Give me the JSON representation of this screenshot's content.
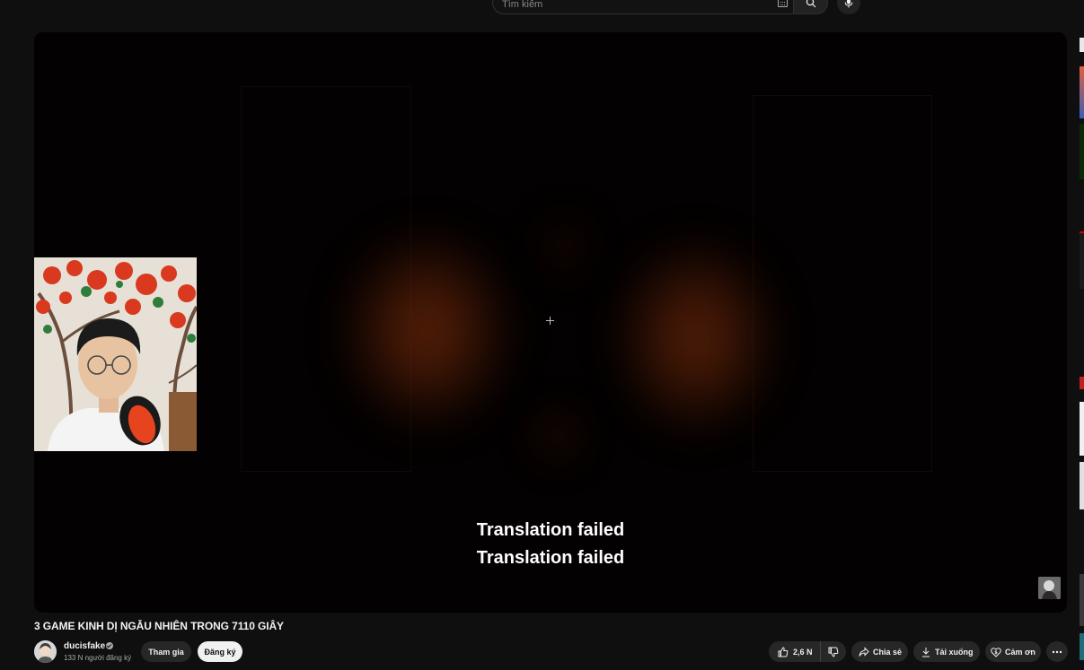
{
  "search": {
    "placeholder": "Tìm kiếm",
    "search_icon": "search-icon",
    "mic_icon": "microphone-icon",
    "keyboard_icon": "keyboard-icon"
  },
  "player": {
    "subtitles": [
      "Translation failed",
      "Translation failed"
    ]
  },
  "video": {
    "title": "3 GAME KINH DỊ NGẪU NHIÊN TRONG 7110 GIÂY"
  },
  "channel": {
    "name": "ducisfake",
    "subscribers": "133 N người đăng ký",
    "join_label": "Tham gia",
    "subscribe_label": "Đăng ký"
  },
  "actions": {
    "likes": "2,6 N",
    "share_label": "Chia sẻ",
    "download_label": "Tải xuống",
    "thanks_label": "Cảm ơn"
  },
  "colors": {
    "background": "#0f0f0f",
    "pill": "#272727",
    "subscribe_bg": "#f1f1f1"
  }
}
